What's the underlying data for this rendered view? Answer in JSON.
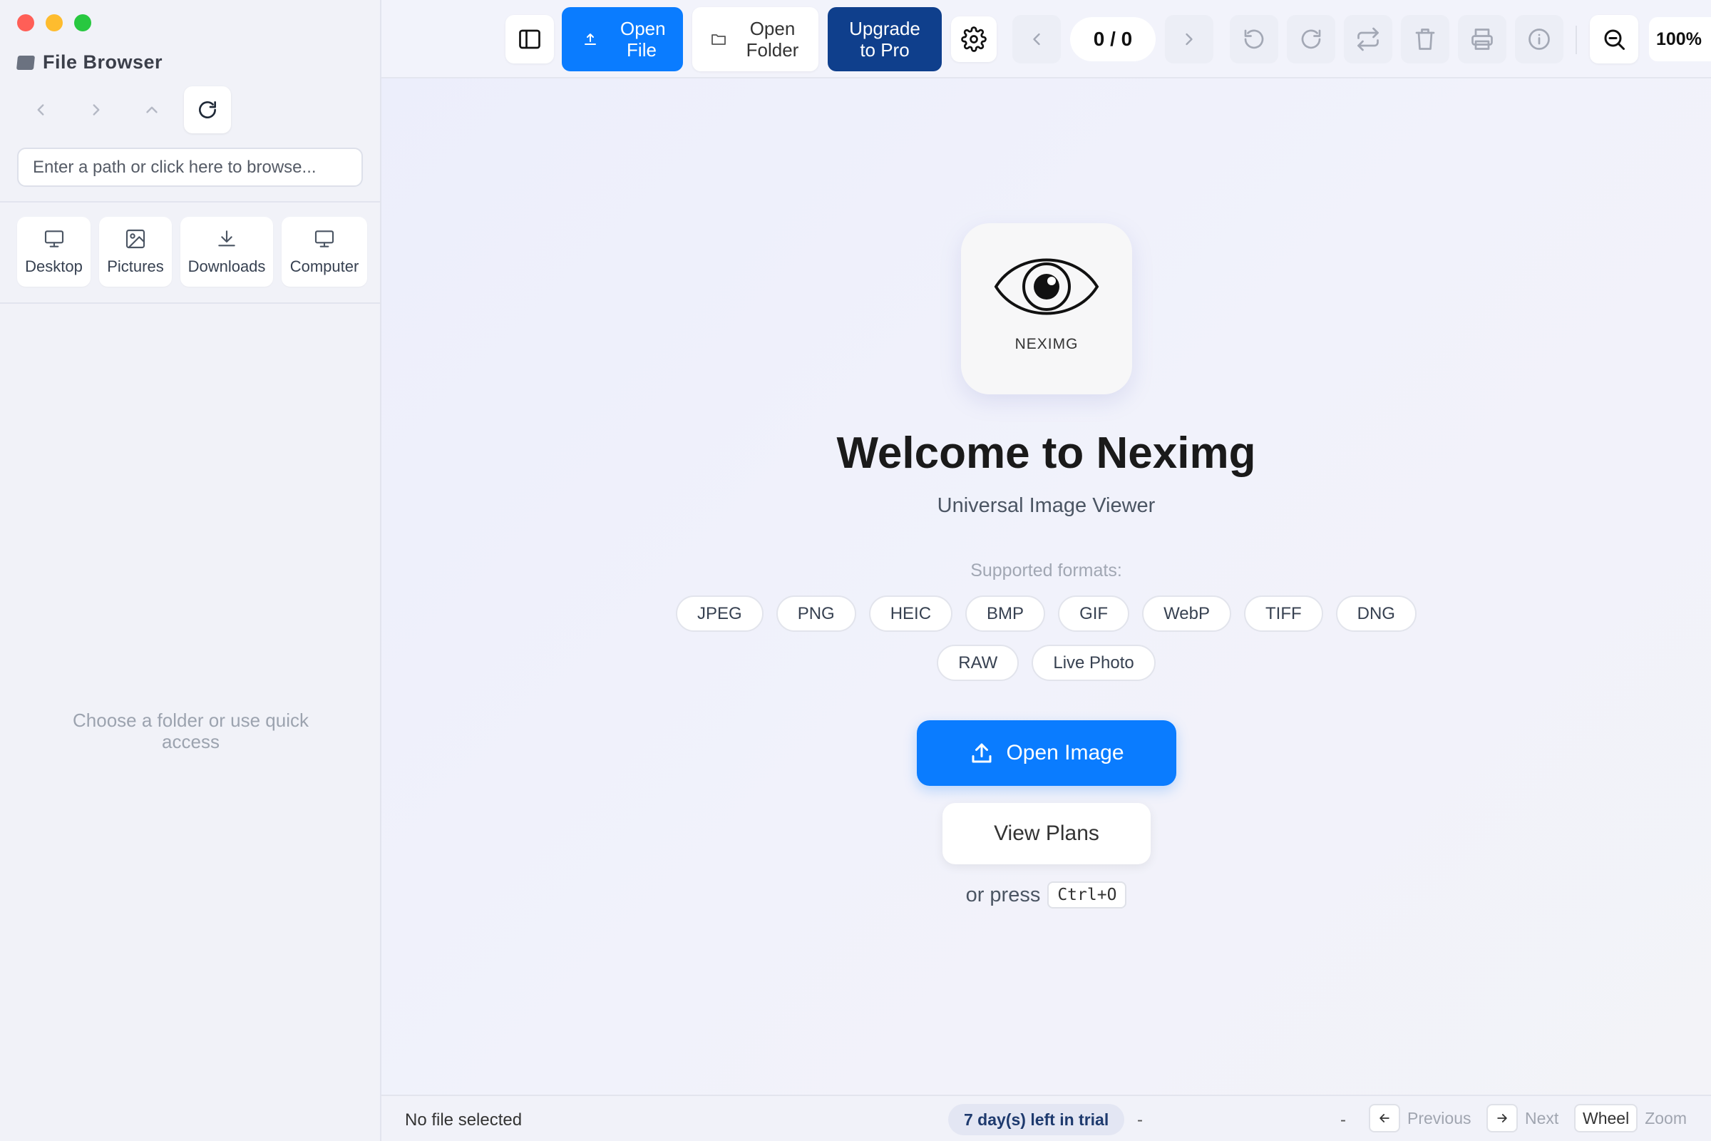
{
  "sidebar": {
    "title": "File Browser",
    "path_placeholder": "Enter a path or click here to browse...",
    "quick_access": [
      {
        "label": "Desktop",
        "icon": "desktop-icon"
      },
      {
        "label": "Pictures",
        "icon": "pictures-icon"
      },
      {
        "label": "Downloads",
        "icon": "download-icon"
      },
      {
        "label": "Computer",
        "icon": "computer-icon"
      }
    ],
    "empty_message": "Choose a folder or use quick access"
  },
  "toolbar": {
    "open_file": "Open File",
    "open_folder": "Open Folder",
    "upgrade": "Upgrade to Pro",
    "counter": "0 / 0",
    "zoom": "100%"
  },
  "welcome": {
    "logo_text": "NEXIMG",
    "title": "Welcome to Neximg",
    "subtitle": "Universal Image Viewer",
    "formats_label": "Supported formats:",
    "formats": [
      "JPEG",
      "PNG",
      "HEIC",
      "BMP",
      "GIF",
      "WebP",
      "TIFF",
      "DNG",
      "RAW",
      "Live Photo"
    ],
    "open_image": "Open Image",
    "view_plans": "View Plans",
    "press_text": "or press",
    "shortcut": "Ctrl+O"
  },
  "status": {
    "file": "No file selected",
    "trial": "7 day(s) left in trial",
    "dash1": "-",
    "dash2": "-",
    "previous": "Previous",
    "next": "Next",
    "wheel_key": "Wheel",
    "zoom": "Zoom"
  },
  "colors": {
    "accent": "#0a7cff",
    "upgrade": "#0f3f8c",
    "trial_text": "#1e3a6e"
  }
}
